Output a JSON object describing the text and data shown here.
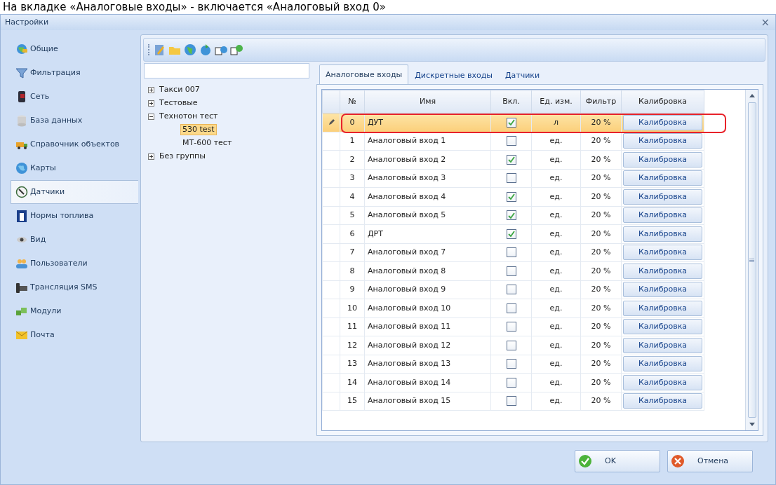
{
  "caption": "На вкладке «Аналоговые входы» - включается «Аналоговый вход 0»",
  "window": {
    "title": "Настройки",
    "close": "×"
  },
  "sidebar": {
    "items": [
      {
        "label": "Общие",
        "selected": false
      },
      {
        "label": "Фильтрация",
        "selected": false
      },
      {
        "label": "Сеть",
        "selected": false
      },
      {
        "label": "База данных",
        "selected": false
      },
      {
        "label": "Справочник объектов",
        "selected": false
      },
      {
        "label": "Карты",
        "selected": false
      },
      {
        "label": "Датчики",
        "selected": true
      },
      {
        "label": "Нормы топлива",
        "selected": false
      },
      {
        "label": "Вид",
        "selected": false
      },
      {
        "label": "Пользователи",
        "selected": false
      },
      {
        "label": "Трансляция SMS",
        "selected": false
      },
      {
        "label": "Модули",
        "selected": false
      },
      {
        "label": "Почта",
        "selected": false
      }
    ]
  },
  "tree": {
    "nodes": [
      {
        "label": "Такси 007",
        "expanded": false,
        "selected": false
      },
      {
        "label": "Тестовые",
        "expanded": false,
        "selected": false
      },
      {
        "label": "Технотон тест",
        "expanded": true,
        "selected": false,
        "children": [
          {
            "label": "530 test",
            "selected": true
          },
          {
            "label": "МТ-600 тест",
            "selected": false
          }
        ]
      },
      {
        "label": "Без группы",
        "expanded": false,
        "selected": false
      }
    ]
  },
  "tabs": [
    {
      "label": "Аналоговые входы",
      "selected": true
    },
    {
      "label": "Дискретные входы",
      "selected": false
    },
    {
      "label": "Датчики",
      "selected": false
    }
  ],
  "table": {
    "columns": [
      "№",
      "Имя",
      "Вкл.",
      "Ед. изм.",
      "Фильтр",
      "Калибровка"
    ],
    "rows": [
      {
        "no": "0",
        "name": "ДУТ",
        "enabled": true,
        "unit": "л",
        "filter": "20 %",
        "action": "Калибровка",
        "selected": true,
        "highlighted": true
      },
      {
        "no": "1",
        "name": "Аналоговый вход 1",
        "enabled": false,
        "unit": "ед.",
        "filter": "20 %",
        "action": "Калибровка",
        "selected": false,
        "highlighted": false
      },
      {
        "no": "2",
        "name": "Аналоговый вход 2",
        "enabled": true,
        "unit": "ед.",
        "filter": "20 %",
        "action": "Калибровка",
        "selected": false,
        "highlighted": false
      },
      {
        "no": "3",
        "name": "Аналоговый вход 3",
        "enabled": false,
        "unit": "ед.",
        "filter": "20 %",
        "action": "Калибровка",
        "selected": false,
        "highlighted": false
      },
      {
        "no": "4",
        "name": "Аналоговый вход 4",
        "enabled": true,
        "unit": "ед.",
        "filter": "20 %",
        "action": "Калибровка",
        "selected": false,
        "highlighted": false
      },
      {
        "no": "5",
        "name": "Аналоговый вход 5",
        "enabled": true,
        "unit": "ед.",
        "filter": "20 %",
        "action": "Калибровка",
        "selected": false,
        "highlighted": false
      },
      {
        "no": "6",
        "name": "ДРТ",
        "enabled": true,
        "unit": "ед.",
        "filter": "20 %",
        "action": "Калибровка",
        "selected": false,
        "highlighted": false
      },
      {
        "no": "7",
        "name": "Аналоговый вход 7",
        "enabled": false,
        "unit": "ед.",
        "filter": "20 %",
        "action": "Калибровка",
        "selected": false,
        "highlighted": false
      },
      {
        "no": "8",
        "name": "Аналоговый вход 8",
        "enabled": false,
        "unit": "ед.",
        "filter": "20 %",
        "action": "Калибровка",
        "selected": false,
        "highlighted": false
      },
      {
        "no": "9",
        "name": "Аналоговый вход 9",
        "enabled": false,
        "unit": "ед.",
        "filter": "20 %",
        "action": "Калибровка",
        "selected": false,
        "highlighted": false
      },
      {
        "no": "10",
        "name": "Аналоговый вход 10",
        "enabled": false,
        "unit": "ед.",
        "filter": "20 %",
        "action": "Калибровка",
        "selected": false,
        "highlighted": false
      },
      {
        "no": "11",
        "name": "Аналоговый вход 11",
        "enabled": false,
        "unit": "ед.",
        "filter": "20 %",
        "action": "Калибровка",
        "selected": false,
        "highlighted": false
      },
      {
        "no": "12",
        "name": "Аналоговый вход 12",
        "enabled": false,
        "unit": "ед.",
        "filter": "20 %",
        "action": "Калибровка",
        "selected": false,
        "highlighted": false
      },
      {
        "no": "13",
        "name": "Аналоговый вход 13",
        "enabled": false,
        "unit": "ед.",
        "filter": "20 %",
        "action": "Калибровка",
        "selected": false,
        "highlighted": false
      },
      {
        "no": "14",
        "name": "Аналоговый вход 14",
        "enabled": false,
        "unit": "ед.",
        "filter": "20 %",
        "action": "Калибровка",
        "selected": false,
        "highlighted": false
      },
      {
        "no": "15",
        "name": "Аналоговый вход 15",
        "enabled": false,
        "unit": "ед.",
        "filter": "20 %",
        "action": "Калибровка",
        "selected": false,
        "highlighted": false
      }
    ]
  },
  "buttons": [
    {
      "label": "OK",
      "kind": "ok"
    },
    {
      "label": "Отмена",
      "kind": "cancel"
    }
  ]
}
